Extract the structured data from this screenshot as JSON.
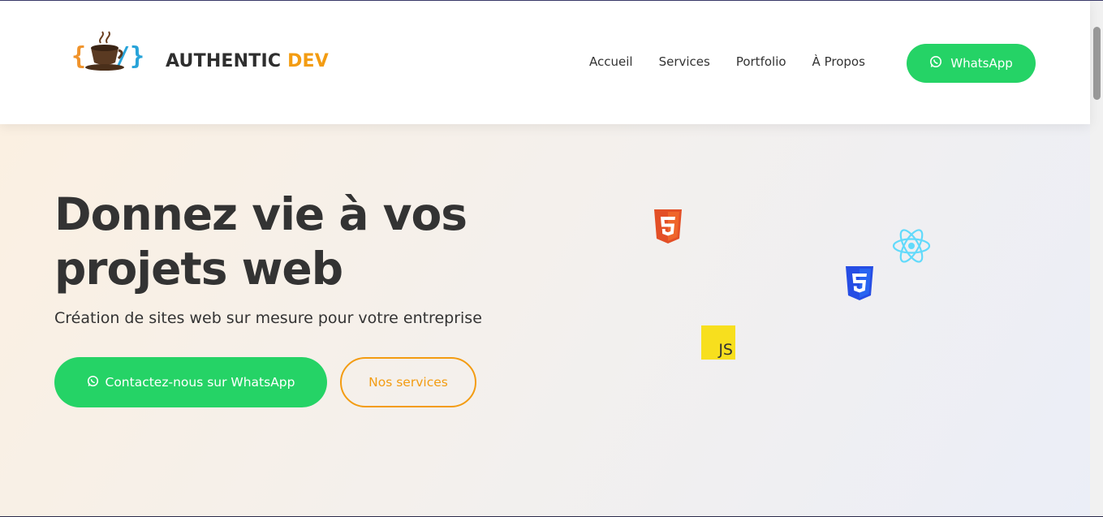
{
  "brand": {
    "name": "AUTHENTIC",
    "accent": "DEV",
    "accent_color": "#f39c12",
    "logo_icon": "coffee-code-logo-icon"
  },
  "nav": {
    "items": [
      {
        "label": "Accueil"
      },
      {
        "label": "Services"
      },
      {
        "label": "Portfolio"
      },
      {
        "label": "À Propos"
      }
    ],
    "whatsapp_label": "WhatsApp",
    "whatsapp_icon": "whatsapp-icon",
    "whatsapp_color": "#25d366"
  },
  "hero": {
    "title": "Donnez vie à vos projets web",
    "subtitle": "Création de sites web sur mesure pour votre entreprise",
    "cta_primary": "Contactez-nous sur WhatsApp",
    "cta_secondary": "Nos services"
  },
  "tech_icons": {
    "html5": "html5-icon",
    "react": "react-icon",
    "css3": "css3-icon",
    "js": "js-icon",
    "js_label": "JS"
  }
}
